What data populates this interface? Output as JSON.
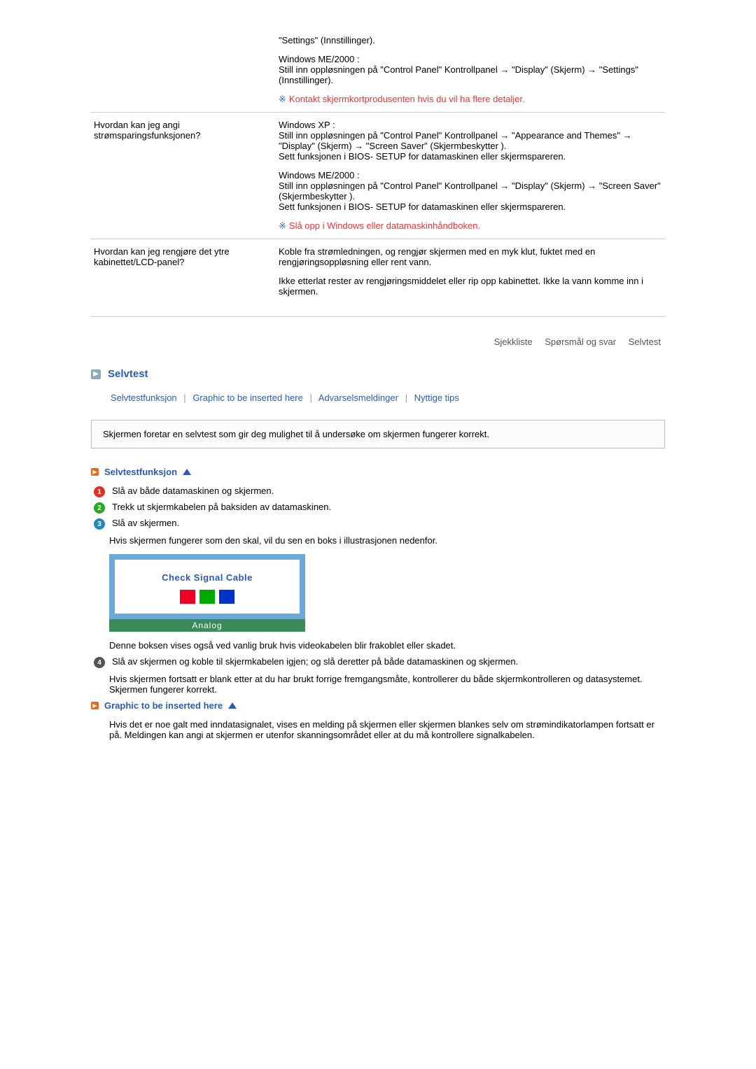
{
  "faq": {
    "rows": [
      {
        "q": "",
        "a1": "\"Settings\" (Innstillinger).",
        "a2": "Windows ME/2000 :\nStill inn oppløsningen på \"Control Panel\" Kontrollpanel → \"Display\" (Skjerm) → \"Settings\" (Innstillinger).",
        "note": "Kontakt skjermkortprodusenten hvis du vil ha flere detaljer."
      },
      {
        "q": "Hvordan kan jeg angi strømsparingsfunksjonen?",
        "a1": "Windows XP :\nStill inn oppløsningen på \"Control Panel\" Kontrollpanel → \"Appearance and Themes\" → \"Display\" (Skjerm) → \"Screen Saver\" (Skjermbeskytter ).\nSett funksjonen i BIOS- SETUP for datamaskinen eller skjermspareren.",
        "a2": "Windows ME/2000 :\nStill inn oppløsningen på \"Control Panel\" Kontrollpanel → \"Display\" (Skjerm) → \"Screen Saver\" (Skjermbeskytter ).\nSett funksjonen i BIOS- SETUP for datamaskinen eller skjermspareren.",
        "note": "Slå opp i Windows eller datamaskinhåndboken."
      },
      {
        "q": "Hvordan kan jeg rengjøre det ytre kabinettet/LCD-panel?",
        "a1": "Koble fra strømledningen, og rengjør skjermen med en myk klut, fuktet med en rengjøringsoppløsning eller rent vann.",
        "a2": "Ikke etterlat rester av rengjøringsmiddelet eller rip opp kabinettet. Ikke la vann komme inn i skjermen.",
        "note": ""
      }
    ]
  },
  "nav": {
    "items": [
      "Sjekkliste",
      "Spørsmål og svar",
      "Selvtest"
    ]
  },
  "section": {
    "title": "Selvtest",
    "links": [
      "Selvtestfunksjon",
      "Graphic to be inserted here",
      "Advarselsmeldinger",
      "Nyttige tips"
    ],
    "intro": "Skjermen foretar en selvtest som gir deg mulighet til å undersøke om skjermen fungerer korrekt."
  },
  "selftest": {
    "heading": "Selvtestfunksjon",
    "steps": [
      "Slå av både datamaskinen og skjermen.",
      "Trekk ut skjermkabelen på baksiden av datamaskinen.",
      "Slå av skjermen."
    ],
    "after3": "Hvis skjermen fungerer som den skal, vil du sen en boks i illustrasjonen nedenfor.",
    "monitor_msg": "Check Signal Cable",
    "monitor_footer": "Analog",
    "after_img": "Denne boksen vises også ved vanlig bruk hvis videokabelen blir frakoblet eller skadet.",
    "step4": "Slå av skjermen og koble til skjermkabelen igjen; og slå deretter på både datamaskinen og skjermen.",
    "after4": "Hvis skjermen fortsatt er blank etter at du har brukt forrige fremgangsmåte, kontrollerer du både skjermkontrolleren og datasystemet. Skjermen fungerer korrekt."
  },
  "graphic": {
    "heading": "Graphic to be inserted here",
    "body": "Hvis det er noe galt med inndatasignalet, vises en melding på skjermen eller skjermen blankes selv om strømindikatorlampen fortsatt er på. Meldingen kan angi at skjermen er utenfor skanningsområdet eller at du må kontrollere signalkabelen."
  }
}
